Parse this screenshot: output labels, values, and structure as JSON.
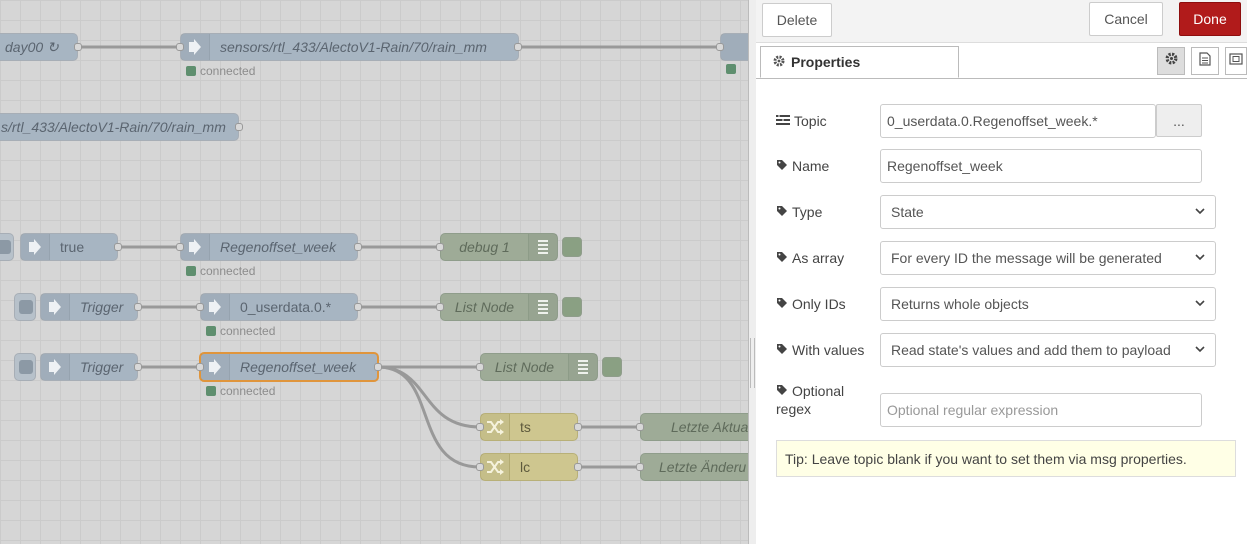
{
  "canvas": {
    "nodes": {
      "n_today": {
        "label": "day00 ↻"
      },
      "n_rain1": {
        "label": "sensors/rtl_433/AlectoV1-Rain/70/rain_mm"
      },
      "n_rain2": {
        "label": "s/rtl_433/AlectoV1-Rain/70/rain_mm"
      },
      "n_true": {
        "label": "true"
      },
      "n_regen1": {
        "label": "Regenoffset_week"
      },
      "n_debug": {
        "label": "debug 1"
      },
      "n_trigger1": {
        "label": "Trigger"
      },
      "n_userdata": {
        "label": "0_userdata.0.*"
      },
      "n_list1": {
        "label": "List Node"
      },
      "n_trigger2": {
        "label": "Trigger"
      },
      "n_regen2": {
        "label": "Regenoffset_week"
      },
      "n_list2": {
        "label": "List Node"
      },
      "n_ts": {
        "label": "ts"
      },
      "n_lc": {
        "label": "lc"
      },
      "n_letzte_akt": {
        "label": "Letzte Aktua"
      },
      "n_letzte_and": {
        "label": "Letzte Änderu"
      }
    },
    "status_connected": "connected"
  },
  "tray": {
    "delete_label": "Delete",
    "cancel_label": "Cancel",
    "done_label": "Done",
    "tab_properties": "Properties",
    "fields": {
      "topic": {
        "label": "Topic",
        "value": "0_userdata.0.Regenoffset_week.*",
        "button": "..."
      },
      "name": {
        "label": "Name",
        "value": "Regenoffset_week"
      },
      "type": {
        "label": "Type",
        "value": "State"
      },
      "as_array": {
        "label": "As array",
        "value": "For every ID the message will be generated"
      },
      "only_ids": {
        "label": "Only IDs",
        "value": "Returns whole objects"
      },
      "with_values": {
        "label": "With values",
        "value": "Read state's values and add them to payload"
      },
      "regex": {
        "label_line1": "Optional",
        "label_line2": "regex",
        "placeholder": "Optional regular expression"
      }
    },
    "tip": "Tip: Leave topic blank if you want to set them via msg properties."
  },
  "colors": {
    "done_button": "#b11b1b",
    "selected_node_border": "#e0953c",
    "status_green": "#5f8f6f"
  },
  "icons": {
    "gear": "gear-icon",
    "tag": "tag-icon",
    "list": "list-icon",
    "arrow": "arrow-in-icon",
    "shuffle": "shuffle-icon"
  }
}
